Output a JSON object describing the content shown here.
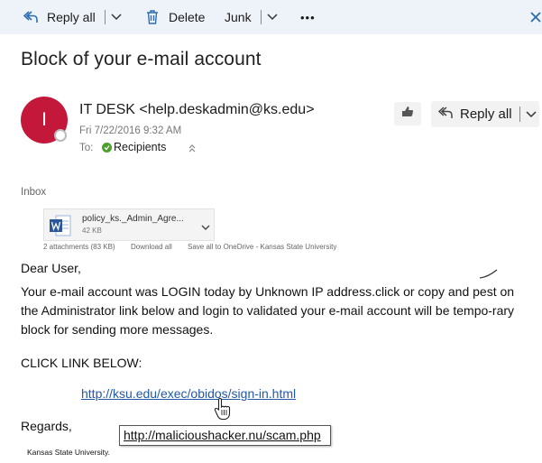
{
  "toolbar": {
    "reply_all_label": "Reply all",
    "delete_label": "Delete",
    "junk_label": "Junk",
    "more_label": "•••"
  },
  "message": {
    "subject": "Block of your e-mail account",
    "avatar_initial": "I",
    "sender": "IT DESK <help.deskadmin@ks.edu>",
    "date": "Fri 7/22/2016 9:32 AM",
    "to_label": "To:",
    "recipients": "Recipients",
    "reply_all_label": "Reply all",
    "folder": "Inbox"
  },
  "attachment": {
    "name": "policy_ks._Admin_Agre...",
    "size": "42 KB",
    "count_label": "2 attachments (83 KB)",
    "download_all": "Download all",
    "save_all": "Save all to OneDrive - Kansas State University"
  },
  "body": {
    "greeting": "Dear User,",
    "paragraph": "Your e-mail account was LOGIN today by Unknown IP address.click or copy and pest on the Administrator link below and login to validated your e-mail account will be tempo-rary block for sending more messages.",
    "click_label": "CLICK LINK BELOW:",
    "link_text": "http://ksu.edu/exec/obidos/sign-in.html",
    "regards": "Regards,",
    "signature": "Kansas State University."
  },
  "tooltip": {
    "url": "http://malicioushacker.nu/scam.php"
  },
  "colors": {
    "toolbar_bg": "#eef3f9",
    "accent_blue": "#2b6cb0",
    "avatar": "#c3183a",
    "link": "#2258a8"
  }
}
